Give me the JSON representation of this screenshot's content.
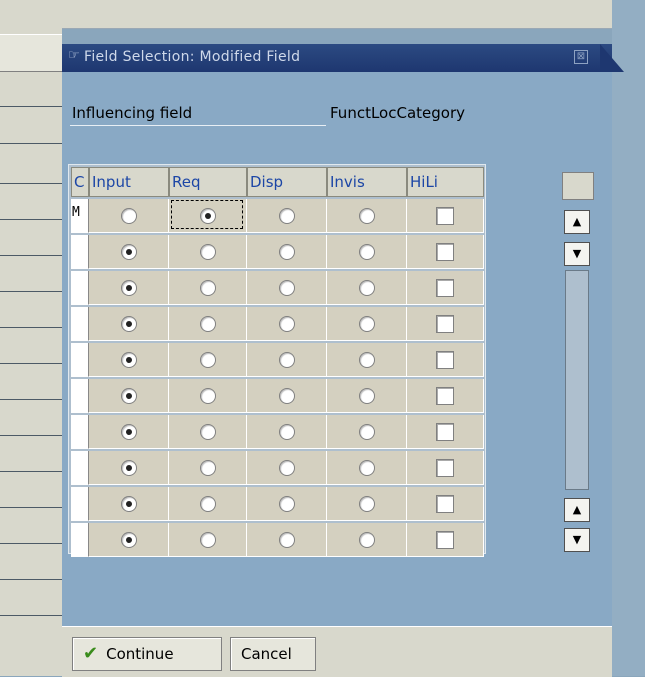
{
  "dialog": {
    "title": "Field Selection: Modified Field",
    "close_symbol": "⊠"
  },
  "influencing": {
    "label": "Influencing field",
    "value": "FunctLocCategory"
  },
  "table": {
    "columns": [
      "C",
      "Input",
      "Req",
      "Disp",
      "Invis",
      "HiLi"
    ],
    "rows": [
      {
        "code": "M",
        "selected": "Req"
      },
      {
        "code": "",
        "selected": "Input"
      },
      {
        "code": "",
        "selected": "Input"
      },
      {
        "code": "",
        "selected": "Input"
      },
      {
        "code": "",
        "selected": "Input"
      },
      {
        "code": "",
        "selected": "Input"
      },
      {
        "code": "",
        "selected": "Input"
      },
      {
        "code": "",
        "selected": "Input"
      },
      {
        "code": "",
        "selected": "Input"
      },
      {
        "code": "",
        "selected": "Input"
      }
    ]
  },
  "scrollbar": {
    "up_symbol": "▲",
    "down_symbol": "▼"
  },
  "footer": {
    "continue_label": "Continue",
    "cancel_label": "Cancel",
    "continue_icon": "check-icon"
  },
  "colors": {
    "titlebar": "#1e3770",
    "dialog_bg": "#89a9c5",
    "header_text": "#1c46a6",
    "continue_check": "#3a8c1c"
  }
}
